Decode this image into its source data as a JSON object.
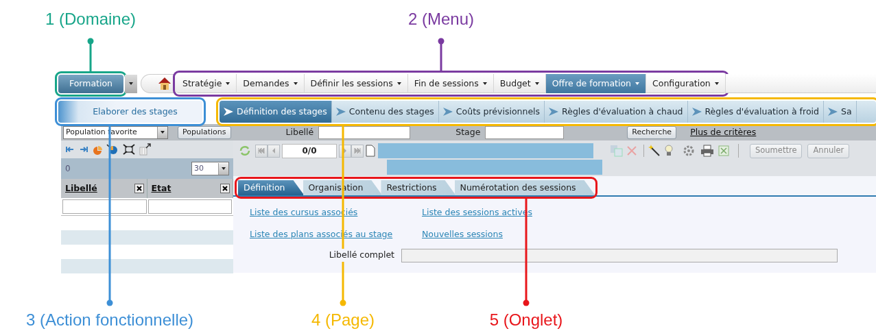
{
  "domain": {
    "label": "Formation",
    "annotation": {
      "label": "1 (Domaine)",
      "color": "#17a589"
    }
  },
  "menu": {
    "annotation": {
      "label": "2 (Menu)",
      "color": "#7a3aa0"
    },
    "items": [
      {
        "label": "Stratégie",
        "selected": false
      },
      {
        "label": "Demandes",
        "selected": false
      },
      {
        "label": "Définir les sessions",
        "selected": false
      },
      {
        "label": "Fin de sessions",
        "selected": false
      },
      {
        "label": "Budget",
        "selected": false
      },
      {
        "label": "Offre de formation",
        "selected": true
      },
      {
        "label": "Configuration",
        "selected": false
      }
    ]
  },
  "action_tab": {
    "label": "Elaborer des stages",
    "annotation": {
      "label": "3 (Action fonctionnelle)",
      "color": "#3d8fd6"
    }
  },
  "pages": {
    "annotation": {
      "label": "4 (Page)",
      "color": "#f5b800"
    },
    "items": [
      {
        "label": "Définition des stages",
        "selected": true
      },
      {
        "label": "Contenu des stages",
        "selected": false
      },
      {
        "label": "Coûts prévisionnels",
        "selected": false
      },
      {
        "label": "Règles d'évaluation à chaud",
        "selected": false
      },
      {
        "label": "Règles d'évaluation à froid",
        "selected": false
      },
      {
        "label": "Sa",
        "selected": false
      }
    ]
  },
  "filter": {
    "population": "Population favorite",
    "populations_button": "Populations",
    "fields": [
      {
        "label": "Libellé"
      },
      {
        "label": "Stage"
      }
    ],
    "search_button": "Recherche",
    "more_link": "Plus de critères"
  },
  "list": {
    "count": "0",
    "page_size": "30",
    "columns": [
      {
        "label": "Libellé"
      },
      {
        "label": "Etat"
      }
    ]
  },
  "record": {
    "pager": "0/0",
    "buttons": [
      {
        "label": "Soumettre",
        "disabled": true
      },
      {
        "label": "Annuler",
        "disabled": true
      }
    ]
  },
  "tabs": {
    "annotation": {
      "label": "5 (Onglet)",
      "color": "#e8161b"
    },
    "items": [
      {
        "label": "Définition",
        "selected": true
      },
      {
        "label": "Organisation",
        "selected": false
      },
      {
        "label": "Restrictions",
        "selected": false
      },
      {
        "label": "Numérotation des sessions",
        "selected": false
      }
    ]
  },
  "links": [
    [
      "Liste des cursus associés",
      "Liste des plans associés au stage"
    ],
    [
      "Liste des sessions actives",
      "Nouvelles sessions"
    ]
  ],
  "full_label_field": {
    "label": "Libellé complet"
  }
}
